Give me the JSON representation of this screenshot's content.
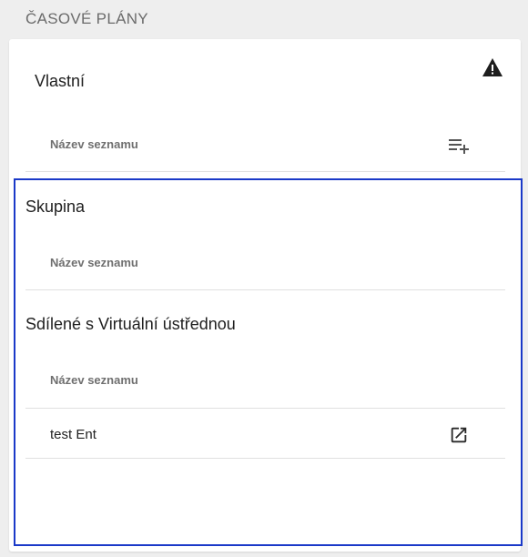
{
  "section": {
    "title": "ČASOVÉ PLÁNY"
  },
  "groups": {
    "custom": {
      "title": "Vlastní",
      "column_header": "Název seznamu",
      "warning_icon": "warning-icon",
      "add_list_icon": "playlist-add-icon"
    },
    "group": {
      "title": "Skupina",
      "column_header": "Název seznamu"
    },
    "shared": {
      "title": "Sdílené s Virtuální ústřednou",
      "column_header": "Název seznamu",
      "rows": [
        {
          "name": "test Ent",
          "icon": "open-in-new-icon"
        }
      ]
    }
  },
  "colors": {
    "highlight_border": "#1a39c8",
    "background": "#eeeeee",
    "card": "#ffffff"
  }
}
